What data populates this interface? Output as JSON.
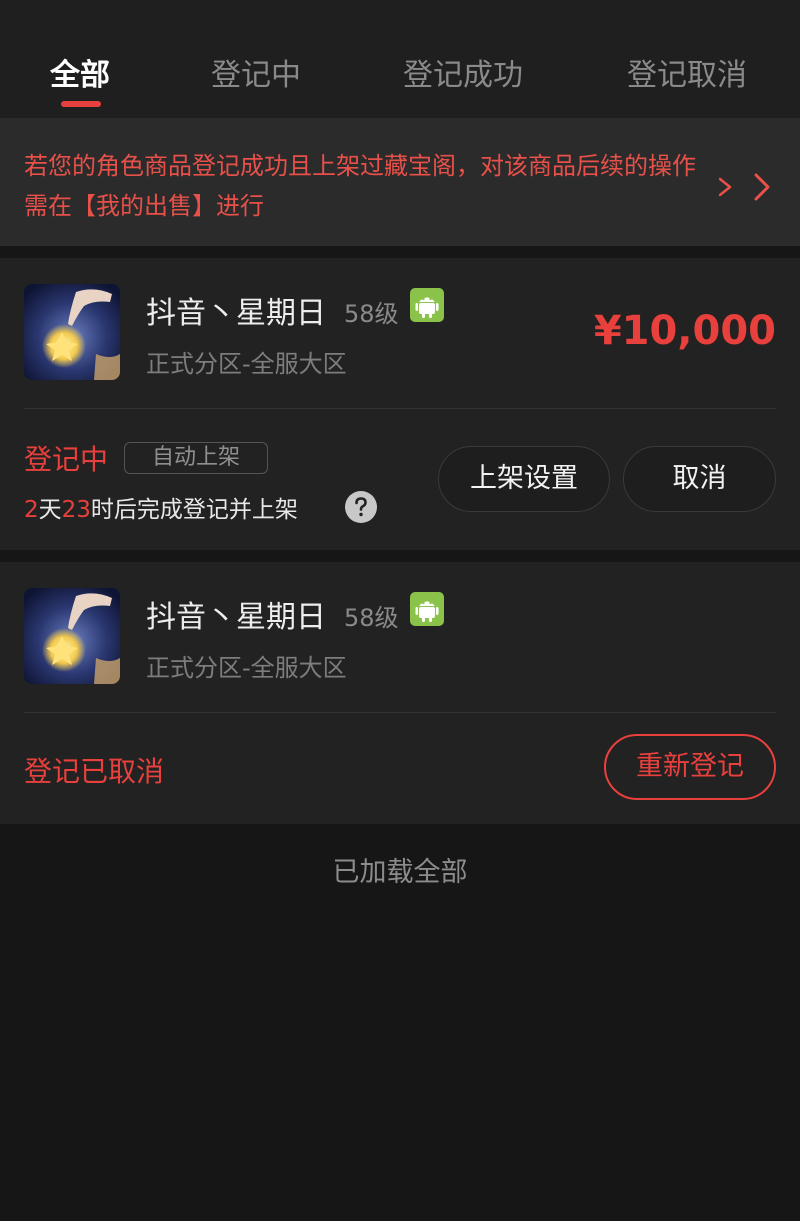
{
  "tabs": [
    {
      "label": "全部",
      "active": true
    },
    {
      "label": "登记中",
      "active": false
    },
    {
      "label": "登记成功",
      "active": false
    },
    {
      "label": "登记取消",
      "active": false
    }
  ],
  "notice": {
    "text": "若您的角色商品登记成功且上架过藏宝阁，对该商品后续的操作需在【我的出售】进行",
    "arrow_icon": "double-chevron-right-icon"
  },
  "items": [
    {
      "name": "抖音丶星期日",
      "level": "58级",
      "platform_icon": "android-icon",
      "server": "正式分区-全服大区",
      "price": "¥10,000",
      "status": "登记中",
      "auto_badge": "自动上架",
      "countdown": {
        "days": "2",
        "days_unit": "天",
        "hours": "23",
        "rest": "时后完成登记并上架"
      },
      "buttons": {
        "shelf_settings": "上架设置",
        "cancel": "取消"
      }
    },
    {
      "name": "抖音丶星期日",
      "level": "58级",
      "platform_icon": "android-icon",
      "server": "正式分区-全服大区",
      "status": "登记已取消",
      "buttons": {
        "reregister": "重新登记"
      }
    }
  ],
  "footer": {
    "text": "已加载全部"
  },
  "colors": {
    "accent": "#e8403c",
    "android": "#8bc34a",
    "background": "#161616",
    "card": "#222222"
  }
}
